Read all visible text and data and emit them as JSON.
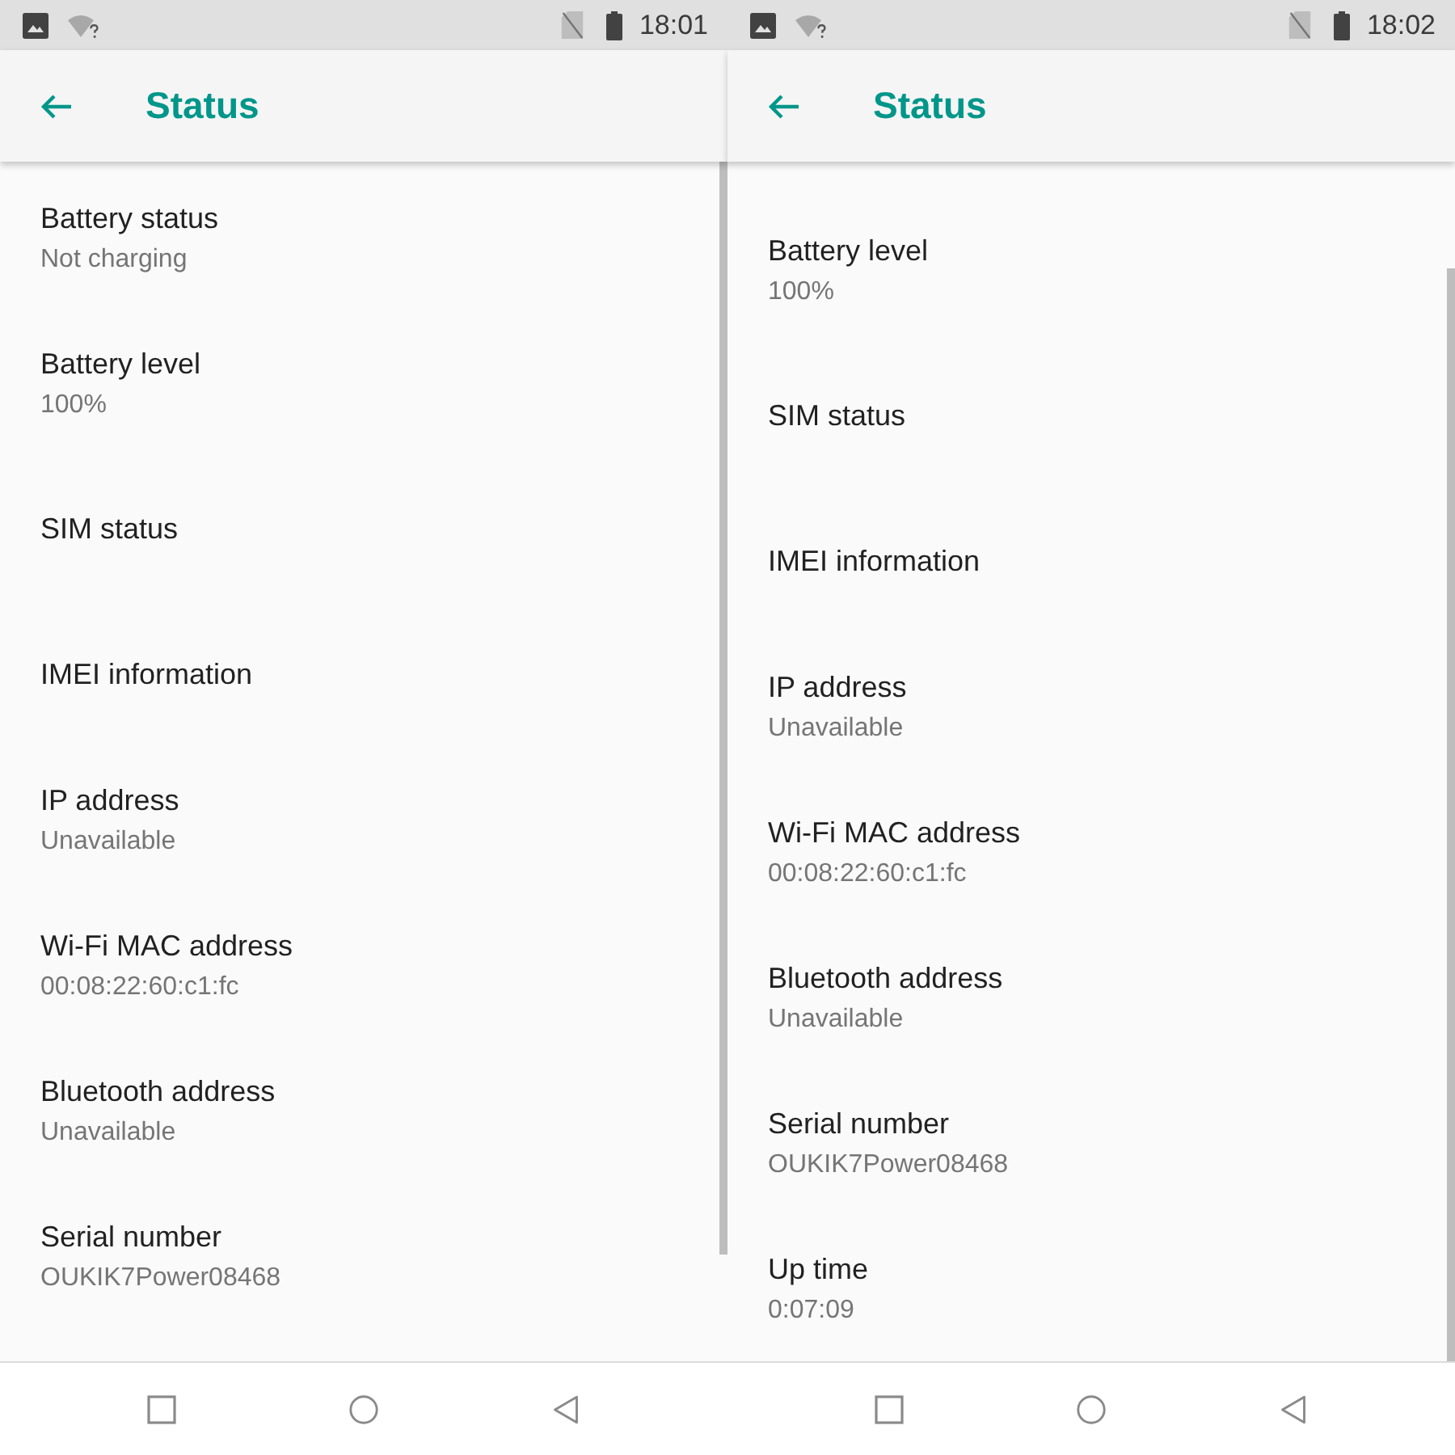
{
  "screens": [
    {
      "status_bar": {
        "time": "18:01"
      },
      "app_bar": {
        "title": "Status"
      },
      "scrolled_down": false,
      "items": [
        {
          "title": "Battery status",
          "summary": "Not charging"
        },
        {
          "title": "Battery level",
          "summary": "100%"
        },
        {
          "title": "SIM status"
        },
        {
          "title": "IMEI information"
        },
        {
          "title": "IP address",
          "summary": "Unavailable"
        },
        {
          "title": "Wi-Fi MAC address",
          "summary": "00:08:22:60:c1:fc"
        },
        {
          "title": "Bluetooth address",
          "summary": "Unavailable"
        },
        {
          "title": "Serial number",
          "summary": "OUKIK7Power08468"
        }
      ]
    },
    {
      "status_bar": {
        "time": "18:02"
      },
      "app_bar": {
        "title": "Status"
      },
      "scrolled_down": true,
      "items": [
        {
          "title": "Battery level",
          "summary": "100%"
        },
        {
          "title": "SIM status"
        },
        {
          "title": "IMEI information"
        },
        {
          "title": "IP address",
          "summary": "Unavailable"
        },
        {
          "title": "Wi-Fi MAC address",
          "summary": "00:08:22:60:c1:fc"
        },
        {
          "title": "Bluetooth address",
          "summary": "Unavailable"
        },
        {
          "title": "Serial number",
          "summary": "OUKIK7Power08468"
        },
        {
          "title": "Up time",
          "summary": "0:07:09"
        }
      ]
    }
  ]
}
